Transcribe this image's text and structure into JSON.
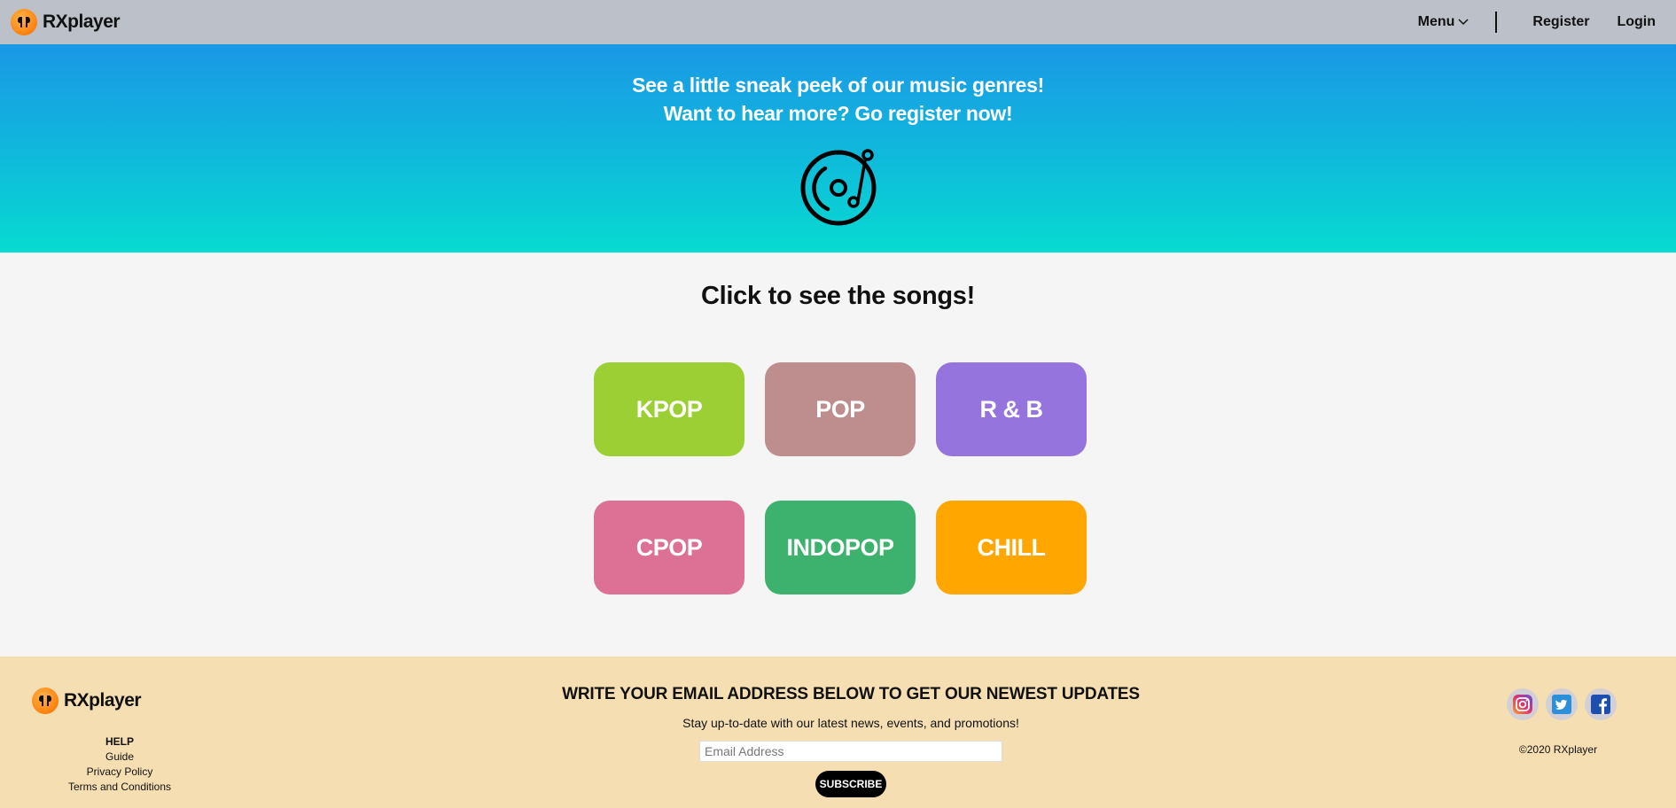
{
  "nav": {
    "brand": "RXplayer",
    "menu_label": "Menu",
    "register_label": "Register",
    "login_label": "Login"
  },
  "hero": {
    "line1": "See a little sneak peek of our music genres!",
    "line2": "Want to hear more? Go register now!",
    "icon": "turntable-icon"
  },
  "main": {
    "title": "Click to see the songs!",
    "genres": [
      {
        "label": "KPOP",
        "color": "#9ccf33"
      },
      {
        "label": "POP",
        "color": "#be8d8d"
      },
      {
        "label": "R & B",
        "color": "#9574de"
      },
      {
        "label": "CPOP",
        "color": "#dd7095"
      },
      {
        "label": "INDOPOP",
        "color": "#3db26e"
      },
      {
        "label": "CHILL",
        "color": "#ffa600"
      }
    ]
  },
  "footer": {
    "brand": "RXplayer",
    "help_title": "HELP",
    "help_links": [
      "Guide",
      "Privacy Policy",
      "Terms and Conditions"
    ],
    "subscribe_title": "WRITE YOUR EMAIL ADDRESS BELOW TO GET OUR NEWEST UPDATES",
    "subscribe_desc": "Stay up-to-date with our latest news, events, and promotions!",
    "email_placeholder": "Email Address",
    "subscribe_button": "SUBSCRIBE",
    "socials": [
      "instagram-icon",
      "twitter-icon",
      "facebook-icon"
    ],
    "copyright": "©2020 RXplayer"
  },
  "colors": {
    "navbar": "#bcc1c9",
    "hero_top": "#1a98e6",
    "hero_bottom": "#07dbd1",
    "footer": "#f6deb3",
    "logo": "#ff8c1a"
  }
}
